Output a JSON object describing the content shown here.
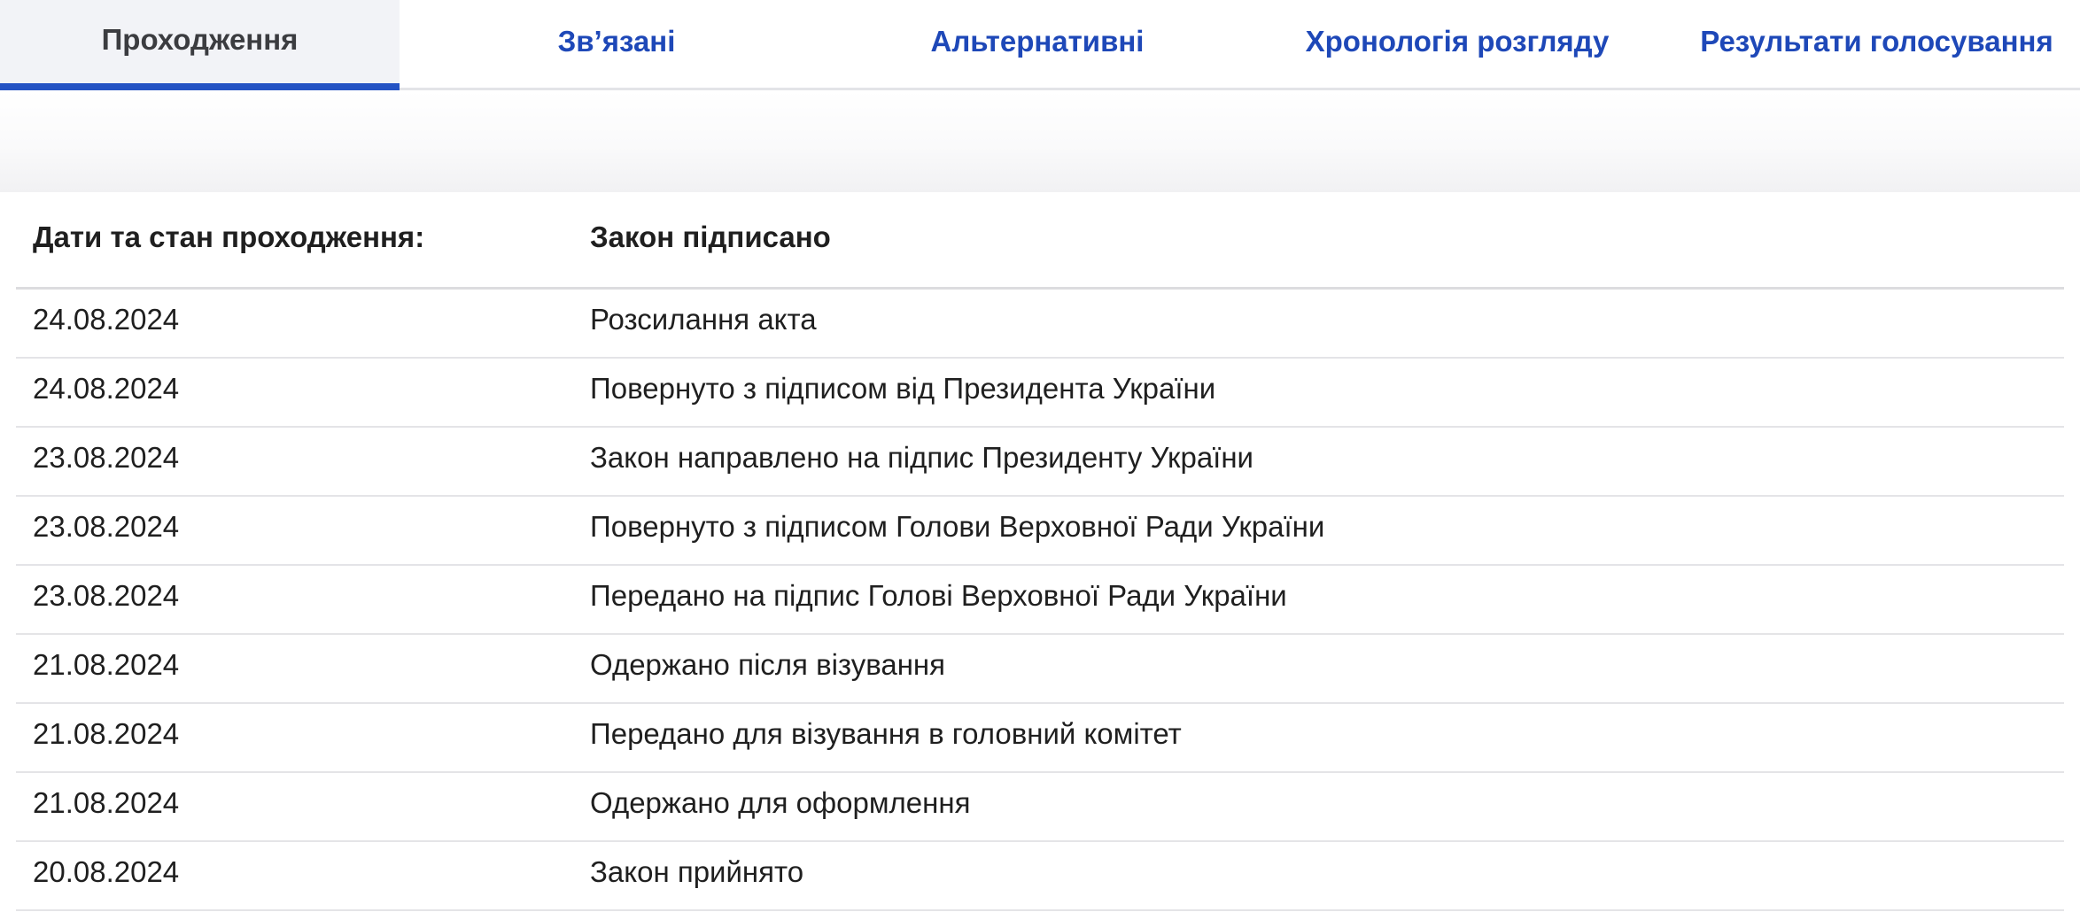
{
  "tabs": [
    {
      "label": "Проходження",
      "active": true
    },
    {
      "label": "Зв’язані",
      "active": false
    },
    {
      "label": "Альтернативні",
      "active": false
    },
    {
      "label": "Хронологія розгляду",
      "active": false
    },
    {
      "label": "Результати голосування",
      "active": false
    }
  ],
  "table": {
    "header": {
      "label": "Дати та стан проходження:",
      "value": "Закон підписано"
    },
    "rows": [
      {
        "date": "24.08.2024",
        "status": "Розсилання акта"
      },
      {
        "date": "24.08.2024",
        "status": "Повернуто з підписом від Президента України"
      },
      {
        "date": "23.08.2024",
        "status": "Закон направлено на підпис Президенту України"
      },
      {
        "date": "23.08.2024",
        "status": "Повернуто з підписом Голови Верховної Ради України"
      },
      {
        "date": "23.08.2024",
        "status": "Передано на підпис Голові Верховної Ради України"
      },
      {
        "date": "21.08.2024",
        "status": "Одержано після візування"
      },
      {
        "date": "21.08.2024",
        "status": "Передано для візування в головний комітет"
      },
      {
        "date": "21.08.2024",
        "status": "Одержано для оформлення"
      },
      {
        "date": "20.08.2024",
        "status": "Закон прийнято"
      }
    ]
  },
  "colors": {
    "tab_text": "#1e48b8",
    "active_tab_text": "#3b3c40",
    "active_tab_background": "#f2f3f7",
    "active_tab_underline": "#2453c4"
  }
}
